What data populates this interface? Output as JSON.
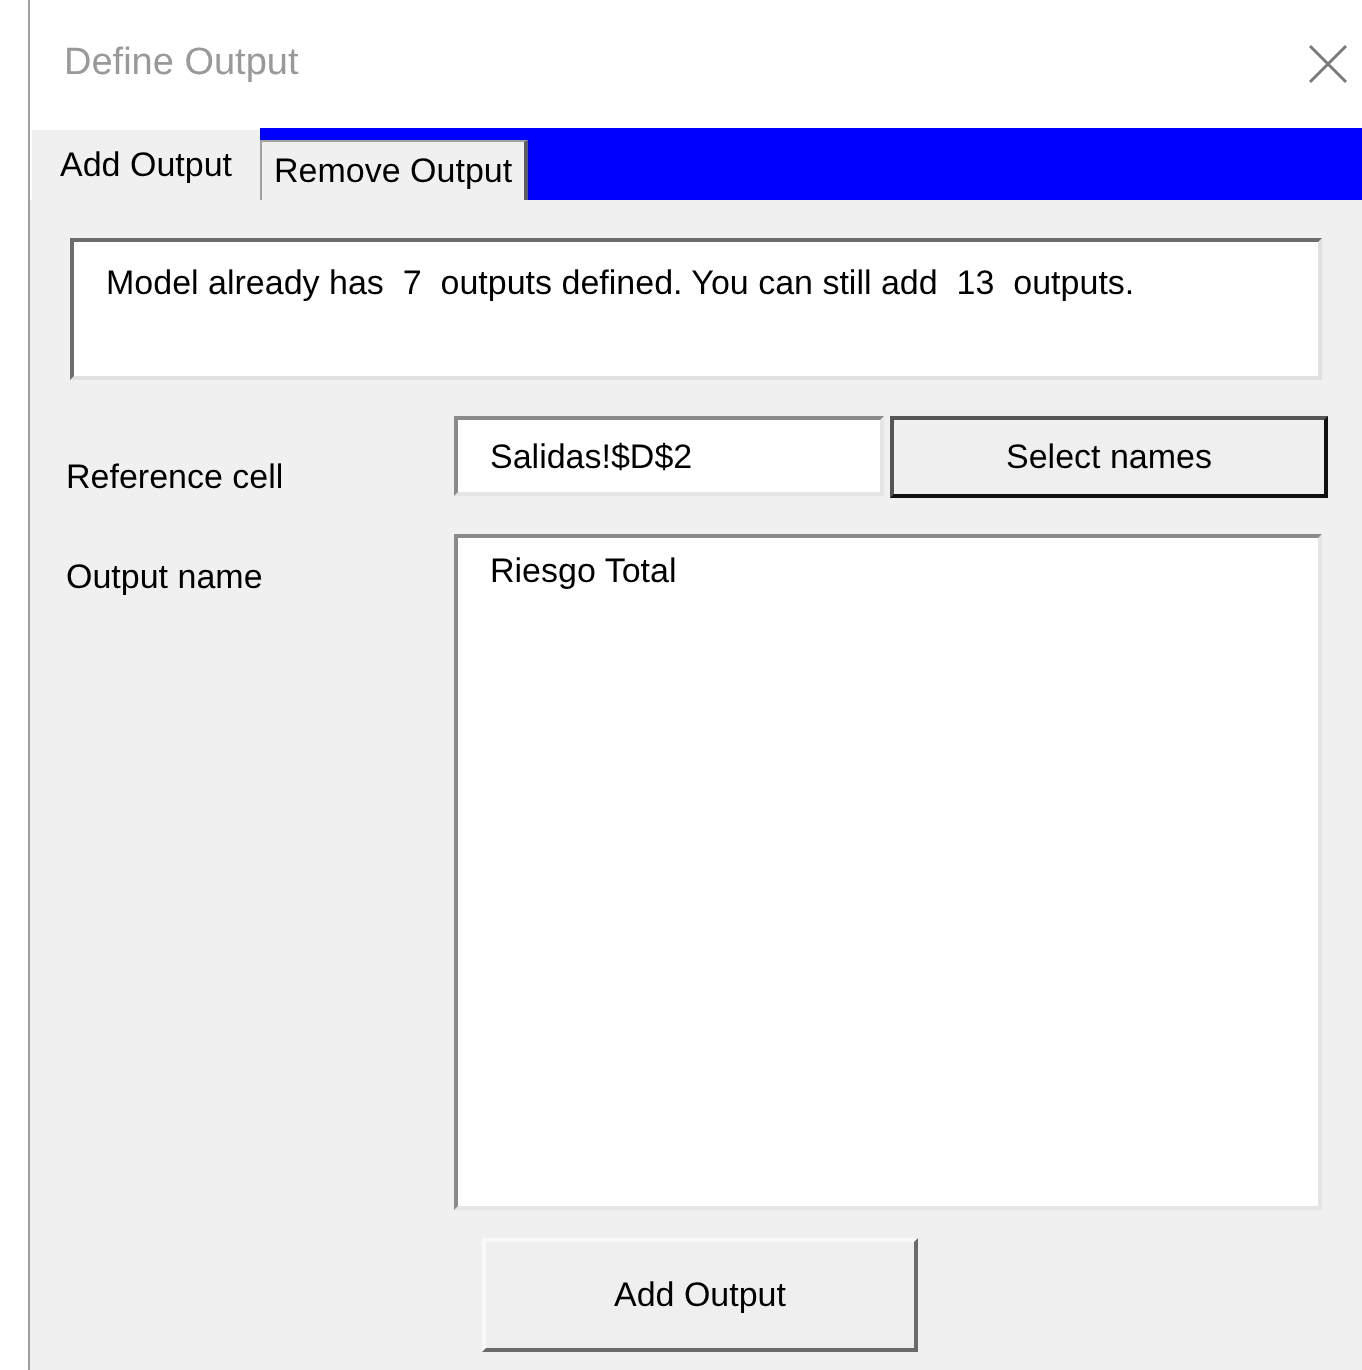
{
  "window": {
    "title": "Define Output"
  },
  "tabs": [
    {
      "label": "Add Output",
      "selected": true
    },
    {
      "label": "Remove Output",
      "selected": false
    }
  ],
  "message": "Model already has  7  outputs defined. You can still add  13  outputs.",
  "reference_cell": {
    "label": "Reference cell",
    "value": "Salidas!$D$2",
    "button": "Select names"
  },
  "output_name": {
    "label": "Output name",
    "value": "Riesgo Total"
  },
  "add_button": "Add Output"
}
